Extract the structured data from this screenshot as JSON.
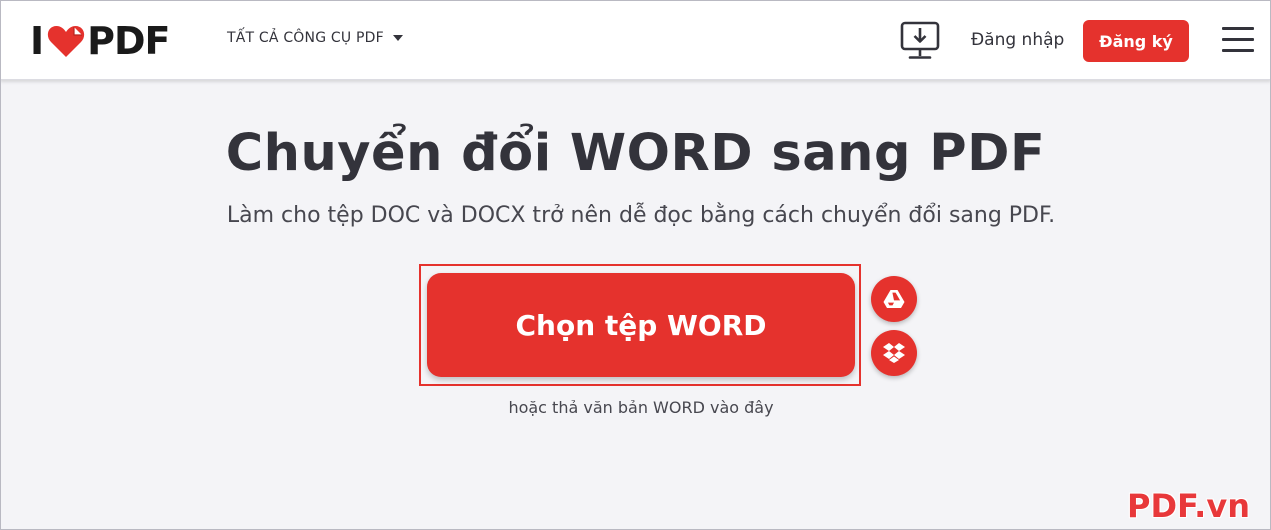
{
  "header": {
    "logo": {
      "left_text": "I",
      "right_text": "PDF",
      "heart_color": "#e5322d"
    },
    "tools_menu_label": "TẤT CẢ CÔNG CỤ PDF",
    "desktop_icon": "desktop-download-icon",
    "login_label": "Đăng nhập",
    "signup_label": "Đăng ký",
    "menu_icon": "hamburger-menu-icon"
  },
  "main": {
    "title": "Chuyển đổi WORD sang PDF",
    "subtitle": "Làm cho tệp DOC và DOCX trở nên dễ đọc bằng cách chuyển đổi sang PDF.",
    "upload_button_label": "Chọn tệp WORD",
    "drop_hint": "hoặc thả văn bản WORD vào đây",
    "cloud_buttons": [
      {
        "icon": "google-drive-icon"
      },
      {
        "icon": "dropbox-icon"
      }
    ]
  },
  "watermark": "PDF.vn",
  "colors": {
    "accent": "#e5322d",
    "text": "#33333b",
    "background": "#f4f4f7"
  }
}
